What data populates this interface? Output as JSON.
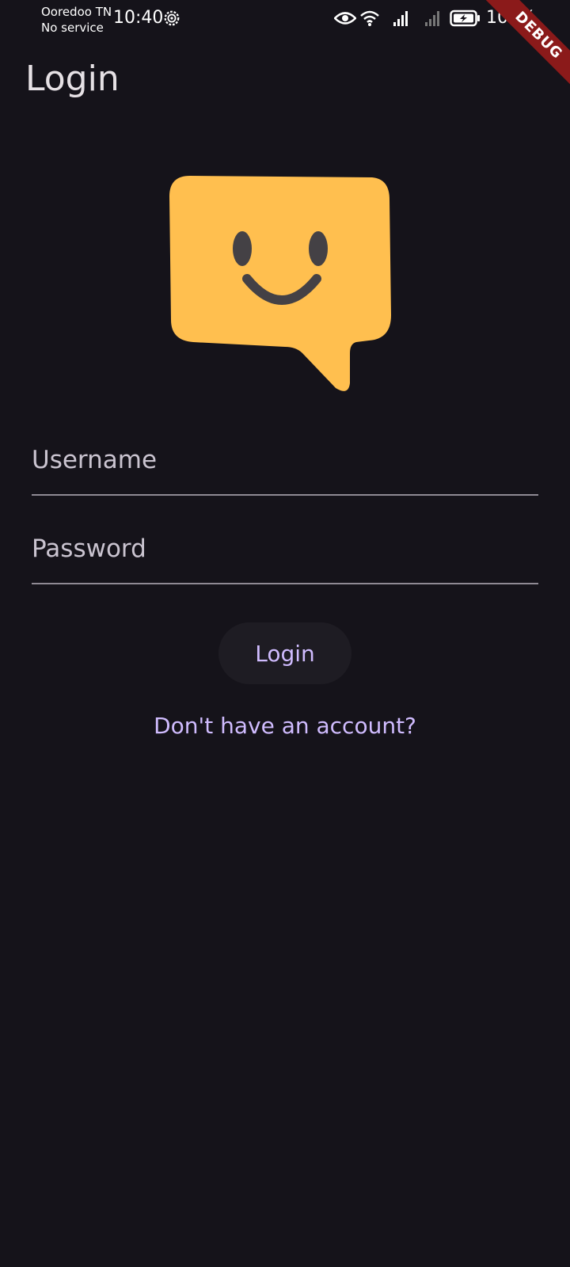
{
  "status_bar": {
    "carrier": "Ooredoo TN",
    "service": "No service",
    "time": "10:40",
    "battery": "100%",
    "icons": [
      "gear-icon",
      "eye-icon",
      "wifi-icon",
      "signal-icon",
      "signal-icon",
      "battery-charging-icon"
    ]
  },
  "debug_banner": "DEBUG",
  "app_bar": {
    "title": "Login"
  },
  "logo": {
    "icon": "smiley-chat-bubble-icon",
    "color": "#ffbf4f",
    "face_color": "#444145"
  },
  "form": {
    "username_placeholder": "Username",
    "password_placeholder": "Password",
    "login_label": "Login",
    "signup_link": "Don't have an account?"
  },
  "colors": {
    "background": "#15131a",
    "accent": "#d0bcff",
    "button_background": "#1e1c23",
    "debug_banner": "#8b1a1a"
  }
}
